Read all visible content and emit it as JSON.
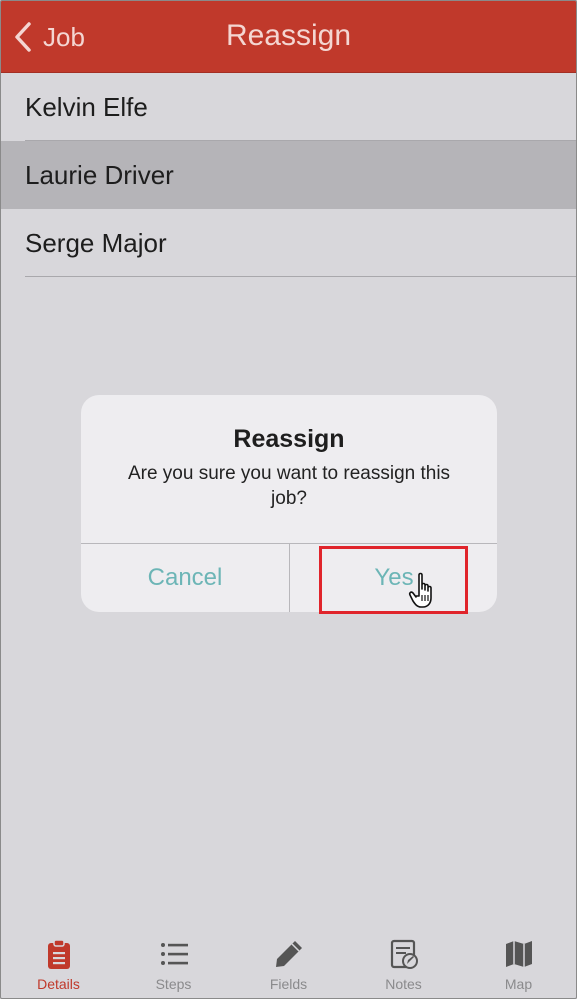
{
  "header": {
    "back_label": "Job",
    "title": "Reassign"
  },
  "list": {
    "items": [
      {
        "name": "Kelvin Elfe"
      },
      {
        "name": "Laurie Driver"
      },
      {
        "name": "Serge Major"
      }
    ]
  },
  "dialog": {
    "title": "Reassign",
    "message": "Are you sure you want to reassign this job?",
    "cancel_label": "Cancel",
    "yes_label": "Yes"
  },
  "tabbar": {
    "tabs": [
      {
        "label": "Details",
        "icon": "clipboard-icon"
      },
      {
        "label": "Steps",
        "icon": "list-icon"
      },
      {
        "label": "Fields",
        "icon": "pencil-icon"
      },
      {
        "label": "Notes",
        "icon": "notes-icon"
      },
      {
        "label": "Map",
        "icon": "map-icon"
      }
    ]
  },
  "colors": {
    "accent": "#c0392b",
    "dialog_button": "#6cb5b6",
    "highlight": "#e0242b",
    "tab_inactive": "#8a8a8c"
  }
}
